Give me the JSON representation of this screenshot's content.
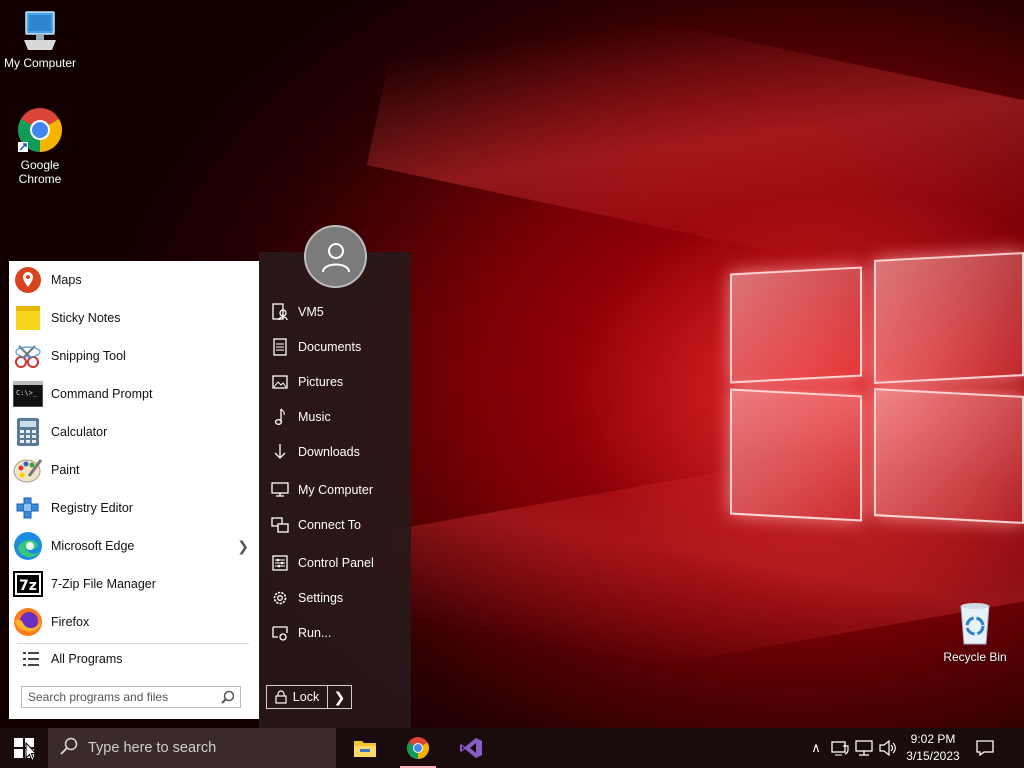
{
  "desktop": {
    "icons": [
      {
        "label": "My Computer"
      },
      {
        "label": "Google Chrome"
      },
      {
        "label": "Recycle Bin"
      }
    ]
  },
  "start_menu": {
    "programs": [
      {
        "label": "Maps",
        "icon": "maps-icon"
      },
      {
        "label": "Sticky Notes",
        "icon": "sticky-notes-icon"
      },
      {
        "label": "Snipping Tool",
        "icon": "snipping-tool-icon"
      },
      {
        "label": "Command Prompt",
        "icon": "command-prompt-icon"
      },
      {
        "label": "Calculator",
        "icon": "calculator-icon"
      },
      {
        "label": "Paint",
        "icon": "paint-icon"
      },
      {
        "label": "Registry Editor",
        "icon": "registry-editor-icon"
      },
      {
        "label": "Microsoft Edge",
        "icon": "edge-icon",
        "has_submenu": true
      },
      {
        "label": "7-Zip File Manager",
        "icon": "7zip-icon"
      },
      {
        "label": "Firefox",
        "icon": "firefox-icon"
      }
    ],
    "all_programs_label": "All Programs",
    "search_placeholder": "Search programs and files",
    "places": [
      {
        "label": "VM5",
        "icon": "user-folder-icon"
      },
      {
        "label": "Documents",
        "icon": "document-icon"
      },
      {
        "label": "Pictures",
        "icon": "picture-icon"
      },
      {
        "label": "Music",
        "icon": "music-icon"
      },
      {
        "label": "Downloads",
        "icon": "download-icon"
      },
      {
        "label": "My Computer",
        "icon": "computer-icon"
      },
      {
        "label": "Connect To",
        "icon": "connect-icon"
      },
      {
        "label": "Control Panel",
        "icon": "control-panel-icon"
      },
      {
        "label": "Settings",
        "icon": "gear-icon"
      },
      {
        "label": "Run...",
        "icon": "run-icon"
      }
    ],
    "lock_label": "Lock"
  },
  "taskbar": {
    "search_placeholder": "Type here to search",
    "apps": [
      "file-explorer-icon",
      "chrome-icon",
      "visual-studio-icon"
    ],
    "time": "9:02 PM",
    "date": "3/15/2023"
  },
  "colors": {
    "accent": "#c40008",
    "taskbar": "#1a0c0d"
  }
}
